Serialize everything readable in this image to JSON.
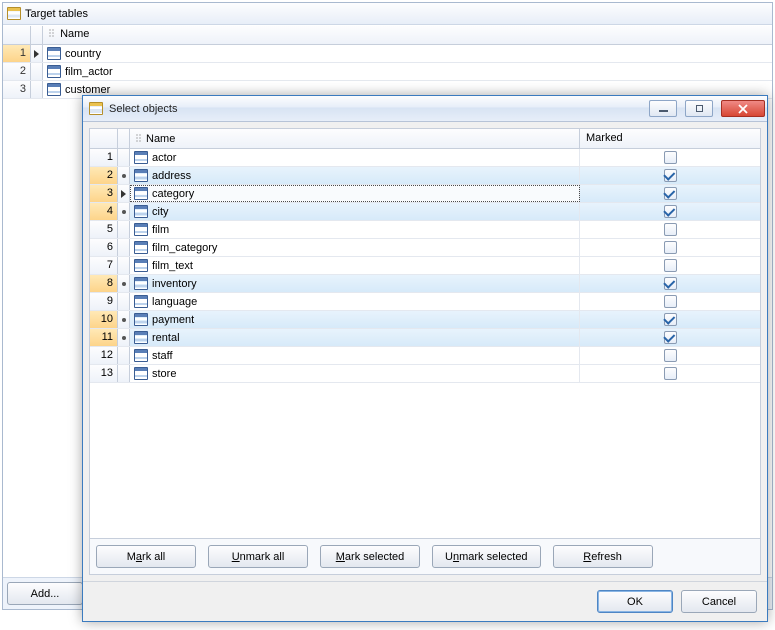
{
  "panel": {
    "title": "Target tables",
    "name_header": "Name",
    "rows": [
      {
        "num": 1,
        "name": "country",
        "selected": true
      },
      {
        "num": 2,
        "name": "film_actor",
        "selected": false
      },
      {
        "num": 3,
        "name": "customer",
        "selected": false
      }
    ],
    "add_label": "Add..."
  },
  "dialog": {
    "title": "Select objects",
    "name_header": "Name",
    "marked_header": "Marked",
    "rows": [
      {
        "num": 1,
        "name": "actor",
        "marked": false,
        "indicator": "none",
        "focus": false
      },
      {
        "num": 2,
        "name": "address",
        "marked": true,
        "indicator": "dot",
        "focus": false
      },
      {
        "num": 3,
        "name": "category",
        "marked": true,
        "indicator": "arrow",
        "focus": true
      },
      {
        "num": 4,
        "name": "city",
        "marked": true,
        "indicator": "dot",
        "focus": false
      },
      {
        "num": 5,
        "name": "film",
        "marked": false,
        "indicator": "none",
        "focus": false
      },
      {
        "num": 6,
        "name": "film_category",
        "marked": false,
        "indicator": "none",
        "focus": false
      },
      {
        "num": 7,
        "name": "film_text",
        "marked": false,
        "indicator": "none",
        "focus": false
      },
      {
        "num": 8,
        "name": "inventory",
        "marked": true,
        "indicator": "dot",
        "focus": false
      },
      {
        "num": 9,
        "name": "language",
        "marked": false,
        "indicator": "none",
        "focus": false
      },
      {
        "num": 10,
        "name": "payment",
        "marked": true,
        "indicator": "dot",
        "focus": false
      },
      {
        "num": 11,
        "name": "rental",
        "marked": true,
        "indicator": "dot",
        "focus": false
      },
      {
        "num": 12,
        "name": "staff",
        "marked": false,
        "indicator": "none",
        "focus": false
      },
      {
        "num": 13,
        "name": "store",
        "marked": false,
        "indicator": "none",
        "focus": false
      }
    ],
    "buttons": {
      "mark_all_pre": "M",
      "mark_all_u": "a",
      "mark_all_post": "rk all",
      "unmark_all_pre": "",
      "unmark_all_u": "U",
      "unmark_all_post": "nmark all",
      "mark_sel_pre": "",
      "mark_sel_u": "M",
      "mark_sel_post": "ark selected",
      "unmark_sel_pre": "U",
      "unmark_sel_u": "n",
      "unmark_sel_post": "mark selected",
      "refresh_pre": "",
      "refresh_u": "R",
      "refresh_post": "efresh",
      "ok": "OK",
      "cancel": "Cancel"
    }
  }
}
